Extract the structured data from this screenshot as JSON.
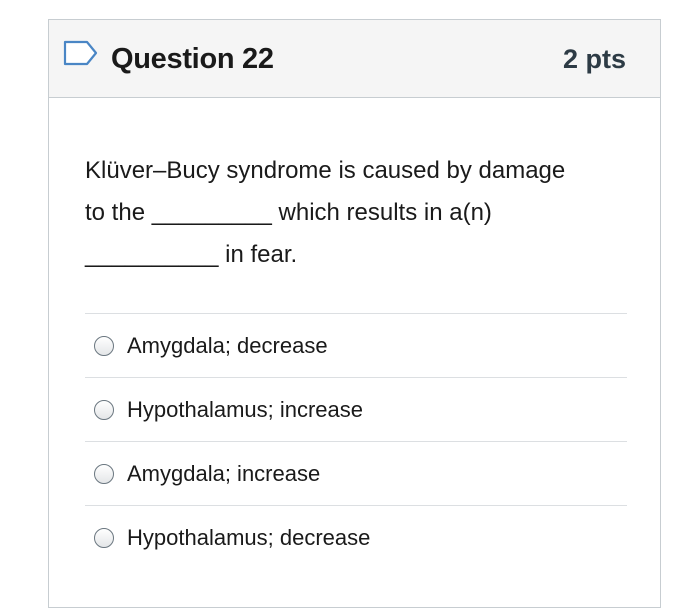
{
  "question": {
    "title": "Question 22",
    "points": "2 pts",
    "flag_icon": "flag-outline-icon",
    "text_lines": [
      "Klüver–Bucy syndrome is caused by damage",
      "to the _________ which results in a(n)",
      "__________ in fear."
    ]
  },
  "answers": [
    {
      "label": "Amygdala; decrease",
      "selected": false
    },
    {
      "label": "Hypothalamus; increase",
      "selected": false
    },
    {
      "label": "Amygdala; increase",
      "selected": false
    },
    {
      "label": "Hypothalamus; decrease",
      "selected": false
    }
  ],
  "colors": {
    "header_bg": "#f5f5f5",
    "border": "#c7cdd1",
    "flag_stroke": "#4a86c5",
    "divider": "#dcdfe2"
  }
}
